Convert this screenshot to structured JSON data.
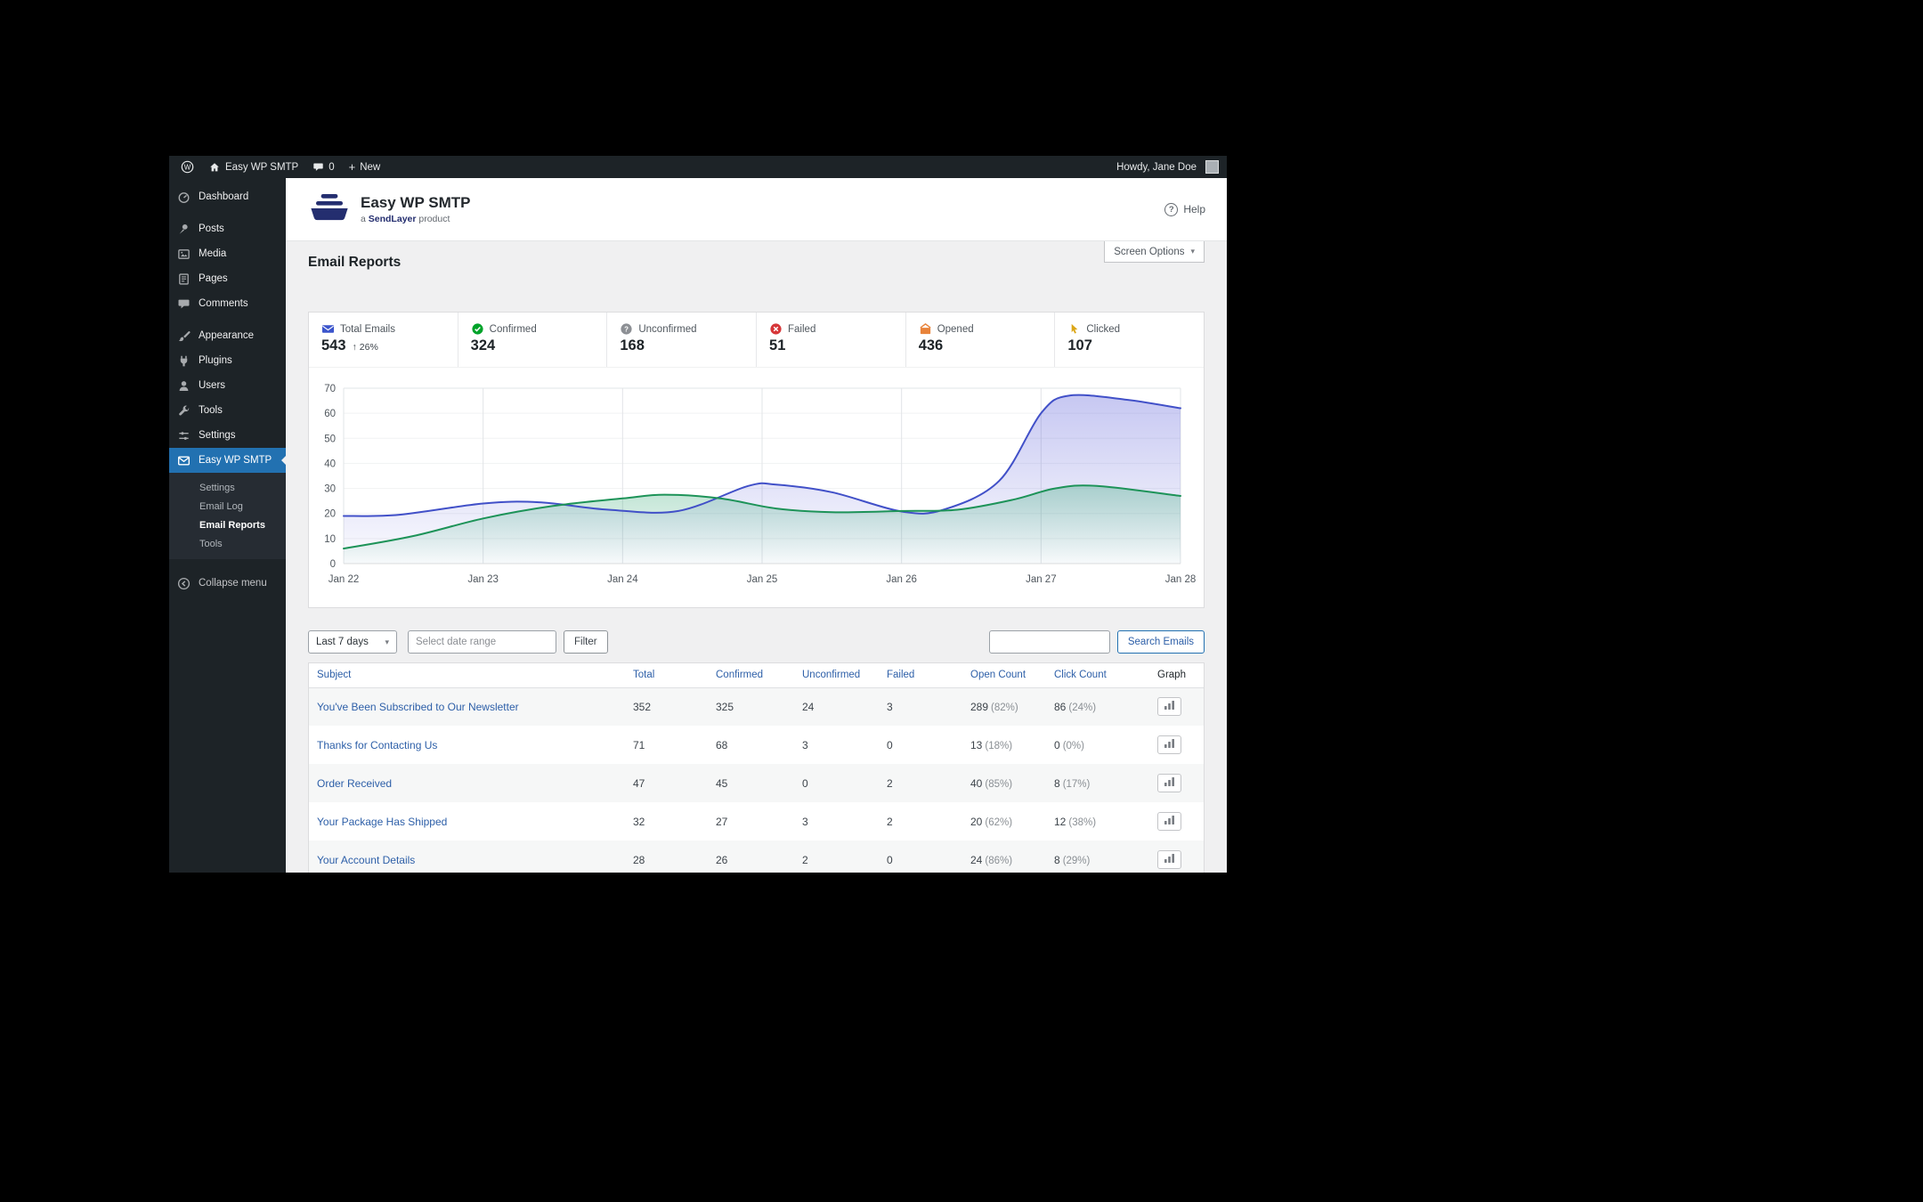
{
  "colors": {
    "admin_dark": "#1d2327",
    "active_menu_blue": "#2271b1",
    "link_blue": "#2d5fa8",
    "brand_navy": "#242e6f",
    "chart_indigo": "#4150c8",
    "chart_green": "#1d9358",
    "success_green": "#00a32a",
    "error_red": "#d63638",
    "opened_orange": "#e8833a",
    "clicked_amber": "#dba617",
    "icon_gray": "#a7aaad",
    "content_bg": "#f0f0f1"
  },
  "icons": {
    "plus": "+",
    "chevron_down": "▾",
    "arrow_up": "↑",
    "help_mark": "?",
    "w_logo": "W"
  },
  "admin_bar": {
    "site_name": "Easy WP SMTP",
    "comments_count": "0",
    "new_label": "New",
    "howdy": "Howdy, Jane Doe"
  },
  "sidebar": {
    "items": [
      {
        "label": "Dashboard",
        "icon": "dashboard-icon"
      },
      {
        "label": "Posts",
        "icon": "pin-icon"
      },
      {
        "label": "Media",
        "icon": "media-icon"
      },
      {
        "label": "Pages",
        "icon": "pages-icon"
      },
      {
        "label": "Comments",
        "icon": "comments-icon"
      },
      {
        "label": "Appearance",
        "icon": "brush-icon"
      },
      {
        "label": "Plugins",
        "icon": "plugin-icon"
      },
      {
        "label": "Users",
        "icon": "user-icon"
      },
      {
        "label": "Tools",
        "icon": "wrench-icon"
      },
      {
        "label": "Settings",
        "icon": "sliders-icon"
      },
      {
        "label": "Easy WP SMTP",
        "icon": "envelope-icon",
        "active": true
      }
    ],
    "submenu": [
      "Settings",
      "Email Log",
      "Email Reports",
      "Tools"
    ],
    "current_submenu": "Email Reports",
    "collapse": "Collapse menu"
  },
  "header": {
    "title": "Easy WP SMTP",
    "subtitle_prefix": "a ",
    "subtitle_brand": "SendLayer",
    "subtitle_suffix": " product",
    "help": "Help"
  },
  "page": {
    "title": "Email Reports",
    "screen_options": "Screen Options"
  },
  "stats": [
    {
      "label": "Total Emails",
      "value": "543",
      "delta": "26%",
      "icon": "envelope-icon"
    },
    {
      "label": "Confirmed",
      "value": "324",
      "icon": "check-circle-icon"
    },
    {
      "label": "Unconfirmed",
      "value": "168",
      "icon": "question-circle-icon"
    },
    {
      "label": "Failed",
      "value": "51",
      "icon": "x-circle-icon"
    },
    {
      "label": "Opened",
      "value": "436",
      "icon": "envelope-open-icon"
    },
    {
      "label": "Clicked",
      "value": "107",
      "icon": "cursor-click-icon"
    }
  ],
  "filters": {
    "range_select": "Last 7 days",
    "date_placeholder": "Select date range",
    "filter_button": "Filter",
    "search_button": "Search Emails",
    "search_value": ""
  },
  "chart_data": {
    "type": "area",
    "title": "",
    "xlabel": "",
    "ylabel": "",
    "x_axis": {
      "labels": [
        "Jan 22",
        "Jan 23",
        "Jan 24",
        "Jan 25",
        "Jan 26",
        "Jan 27",
        "Jan 28"
      ]
    },
    "y_axis": {
      "min": 0,
      "max": 70,
      "ticks": [
        0,
        10,
        20,
        30,
        40,
        50,
        60,
        70
      ]
    },
    "grid": "vertical",
    "legend": "none",
    "series": [
      {
        "name": "indigo",
        "color": "#4150c8",
        "fill_from": "rgba(79,82,214,0.32)",
        "fill_to": "rgba(79,82,214,0.02)",
        "points": [
          [
            0,
            19
          ],
          [
            0.4,
            19.5
          ],
          [
            1,
            24
          ],
          [
            1.4,
            24.5
          ],
          [
            1.9,
            21.5
          ],
          [
            2.4,
            21
          ],
          [
            2.9,
            31
          ],
          [
            3.1,
            31.5
          ],
          [
            3.5,
            28.5
          ],
          [
            4,
            20.8
          ],
          [
            4.3,
            21.5
          ],
          [
            4.7,
            33
          ],
          [
            5,
            60
          ],
          [
            5.2,
            67
          ],
          [
            5.6,
            65.5
          ],
          [
            6,
            62
          ]
        ]
      },
      {
        "name": "green",
        "color": "#1d9358",
        "fill_from": "rgba(34,160,104,0.30)",
        "fill_to": "rgba(34,160,104,0.02)",
        "points": [
          [
            0,
            6
          ],
          [
            0.5,
            11
          ],
          [
            1,
            18
          ],
          [
            1.5,
            23
          ],
          [
            2,
            26
          ],
          [
            2.3,
            27.5
          ],
          [
            2.7,
            26
          ],
          [
            3.1,
            22
          ],
          [
            3.5,
            20.5
          ],
          [
            4,
            21
          ],
          [
            4.4,
            21.5
          ],
          [
            4.8,
            25.5
          ],
          [
            5.1,
            30
          ],
          [
            5.4,
            31
          ],
          [
            6,
            27
          ]
        ]
      }
    ]
  },
  "table": {
    "headers": [
      "Subject",
      "Total",
      "Confirmed",
      "Unconfirmed",
      "Failed",
      "Open Count",
      "Click Count",
      "Graph"
    ],
    "rows": [
      {
        "subject": "You've Been Subscribed to Our Newsletter",
        "total": "352",
        "confirmed": "325",
        "unconfirmed": "24",
        "failed": "3",
        "open": "289",
        "open_pct": "(82%)",
        "click": "86",
        "click_pct": "(24%)"
      },
      {
        "subject": "Thanks for Contacting Us",
        "total": "71",
        "confirmed": "68",
        "unconfirmed": "3",
        "failed": "0",
        "open": "13",
        "open_pct": "(18%)",
        "click": "0",
        "click_pct": "(0%)"
      },
      {
        "subject": "Order Received",
        "total": "47",
        "confirmed": "45",
        "unconfirmed": "0",
        "failed": "2",
        "open": "40",
        "open_pct": "(85%)",
        "click": "8",
        "click_pct": "(17%)"
      },
      {
        "subject": "Your Package Has Shipped",
        "total": "32",
        "confirmed": "27",
        "unconfirmed": "3",
        "failed": "2",
        "open": "20",
        "open_pct": "(62%)",
        "click": "12",
        "click_pct": "(38%)"
      },
      {
        "subject": "Your Account Details",
        "total": "28",
        "confirmed": "26",
        "unconfirmed": "2",
        "failed": "0",
        "open": "24",
        "open_pct": "(86%)",
        "click": "8",
        "click_pct": "(29%)"
      }
    ]
  }
}
